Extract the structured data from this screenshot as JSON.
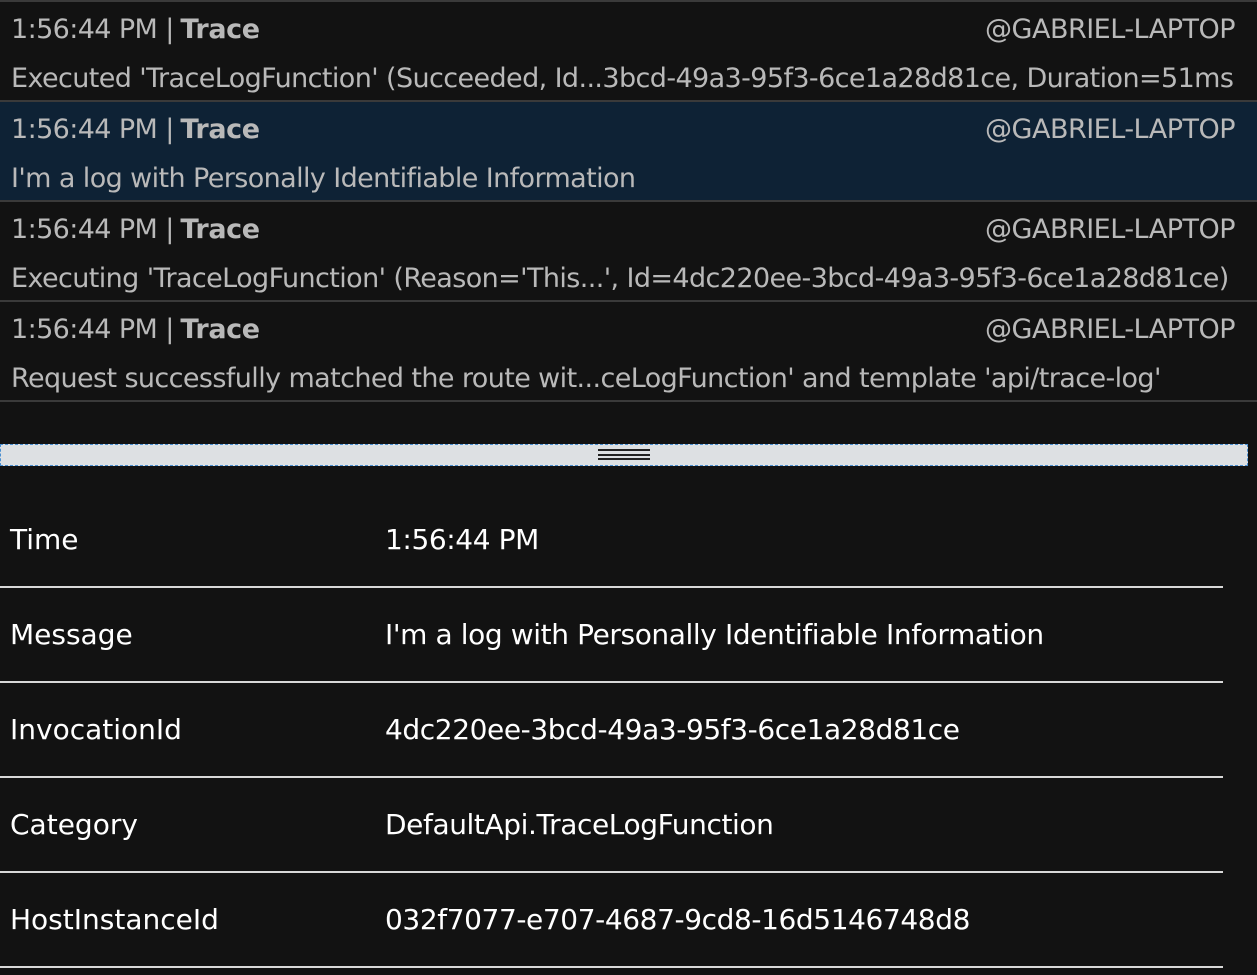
{
  "log_entries": [
    {
      "time": "1:56:44 PM",
      "separator": "|",
      "level": "Trace",
      "host": "@GABRIEL-LAPTOP",
      "message": "Executed 'TraceLogFunction' (Succeeded, Id...3bcd-49a3-95f3-6ce1a28d81ce, Duration=51ms"
    },
    {
      "time": "1:56:44 PM",
      "separator": "|",
      "level": "Trace",
      "host": "@GABRIEL-LAPTOP",
      "message": "I'm a log with Personally Identifiable Information"
    },
    {
      "time": "1:56:44 PM",
      "separator": "|",
      "level": "Trace",
      "host": "@GABRIEL-LAPTOP",
      "message": "Executing 'TraceLogFunction' (Reason='This...', Id=4dc220ee-3bcd-49a3-95f3-6ce1a28d81ce)"
    },
    {
      "time": "1:56:44 PM",
      "separator": "|",
      "level": "Trace",
      "host": "@GABRIEL-LAPTOP",
      "message": "Request successfully matched the route wit...ceLogFunction' and template 'api/trace-log'"
    }
  ],
  "selected_entry": 2,
  "details": [
    {
      "key": "Time",
      "value": "1:56:44 PM"
    },
    {
      "key": "Message",
      "value": "I'm a log with Personally Identifiable Information"
    },
    {
      "key": "InvocationId",
      "value": "4dc220ee-3bcd-49a3-95f3-6ce1a28d81ce"
    },
    {
      "key": "Category",
      "value": "DefaultApi.TraceLogFunction"
    },
    {
      "key": "HostInstanceId",
      "value": "032f7077-e707-4687-9cd8-16d5146748d8"
    }
  ],
  "colors": {
    "background": "#121212",
    "selected_row": "#0e2235",
    "log_text": "#b9b9b9",
    "detail_text": "#ffffff",
    "splitter": "#dde0e3"
  }
}
